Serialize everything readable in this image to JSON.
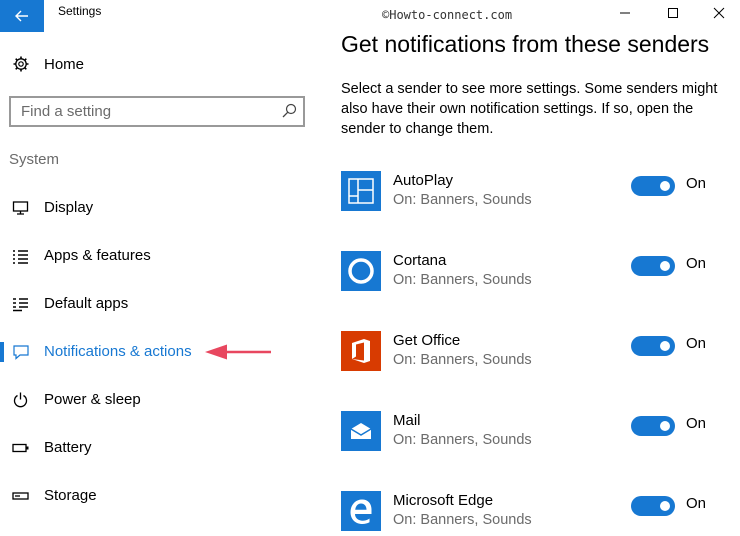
{
  "window": {
    "title": "Settings",
    "watermark": "©Howto-connect.com"
  },
  "sidebar": {
    "home_label": "Home",
    "search_placeholder": "Find a setting",
    "section_label": "System",
    "items": [
      {
        "label": "Display",
        "icon": "monitor-icon"
      },
      {
        "label": "Apps & features",
        "icon": "list-icon"
      },
      {
        "label": "Default apps",
        "icon": "default-apps-icon"
      },
      {
        "label": "Notifications & actions",
        "icon": "notification-icon",
        "active": true
      },
      {
        "label": "Power & sleep",
        "icon": "power-icon"
      },
      {
        "label": "Battery",
        "icon": "battery-icon"
      },
      {
        "label": "Storage",
        "icon": "storage-icon"
      }
    ]
  },
  "main": {
    "title": "Get notifications from these senders",
    "description": "Select a sender to see more settings. Some senders might also have their own notification settings. If so, open the sender to change them.",
    "senders": [
      {
        "name": "AutoPlay",
        "status": "On: Banners, Sounds",
        "toggle_label": "On",
        "icon": "autoplay-icon",
        "icon_color": "#1778d2"
      },
      {
        "name": "Cortana",
        "status": "On: Banners, Sounds",
        "toggle_label": "On",
        "icon": "cortana-icon",
        "icon_color": "#1778d2"
      },
      {
        "name": "Get Office",
        "status": "On: Banners, Sounds",
        "toggle_label": "On",
        "icon": "office-icon",
        "icon_color": "#d83b01"
      },
      {
        "name": "Mail",
        "status": "On: Banners, Sounds",
        "toggle_label": "On",
        "icon": "mail-icon",
        "icon_color": "#1778d2"
      },
      {
        "name": "Microsoft Edge",
        "status": "On: Banners, Sounds",
        "toggle_label": "On",
        "icon": "edge-icon",
        "icon_color": "#1778d2"
      }
    ]
  },
  "colors": {
    "accent": "#1778d2",
    "office": "#d83b01",
    "annotation_arrow": "#e8475f"
  }
}
